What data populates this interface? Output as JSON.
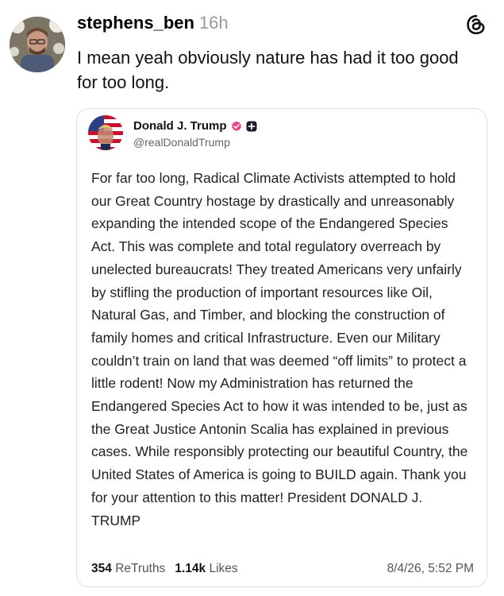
{
  "post": {
    "username": "stephens_ben",
    "time": "16h",
    "text": "I mean yeah obviously nature has had it too good for too long.",
    "icons": {
      "app": "threads-icon",
      "avatar": "avatar"
    }
  },
  "quoted": {
    "display_name": "Donald J. Trump",
    "handle": "@realDonaldTrump",
    "body": "For far too long, Radical Climate Activists attempted to hold our Great Country hostage by drastically and unreasonably expanding the intended scope of the Endangered Species Act. This was complete and total regulatory overreach by unelected bureaucrats! They treated Americans very unfairly by stifling the production of important resources like Oil, Natural Gas, and Timber, and blocking the construction of family homes and critical Infrastructure. Even our Military couldn’t train on land that was deemed “off limits” to protect a little rodent! Now my Administration has returned the Endangered Species Act to how it was intended to be, just as the Great Justice Antonin Scalia has explained in previous cases. While responsibly protecting our beautiful Country, the United States of America is going to BUILD again. Thank you for your attention to this matter! President DONALD J. TRUMP",
    "retruths_count": "354",
    "retruths_label": "ReTruths",
    "likes_count": "1.14k",
    "likes_label": "Likes",
    "date": "8/4/26, 5:52 PM",
    "icons": {
      "verified": "verified-badge-icon",
      "plus": "plus-badge-icon"
    }
  },
  "colors": {
    "verified": "#e8418d",
    "muted": "#999999",
    "border": "#dedede"
  }
}
